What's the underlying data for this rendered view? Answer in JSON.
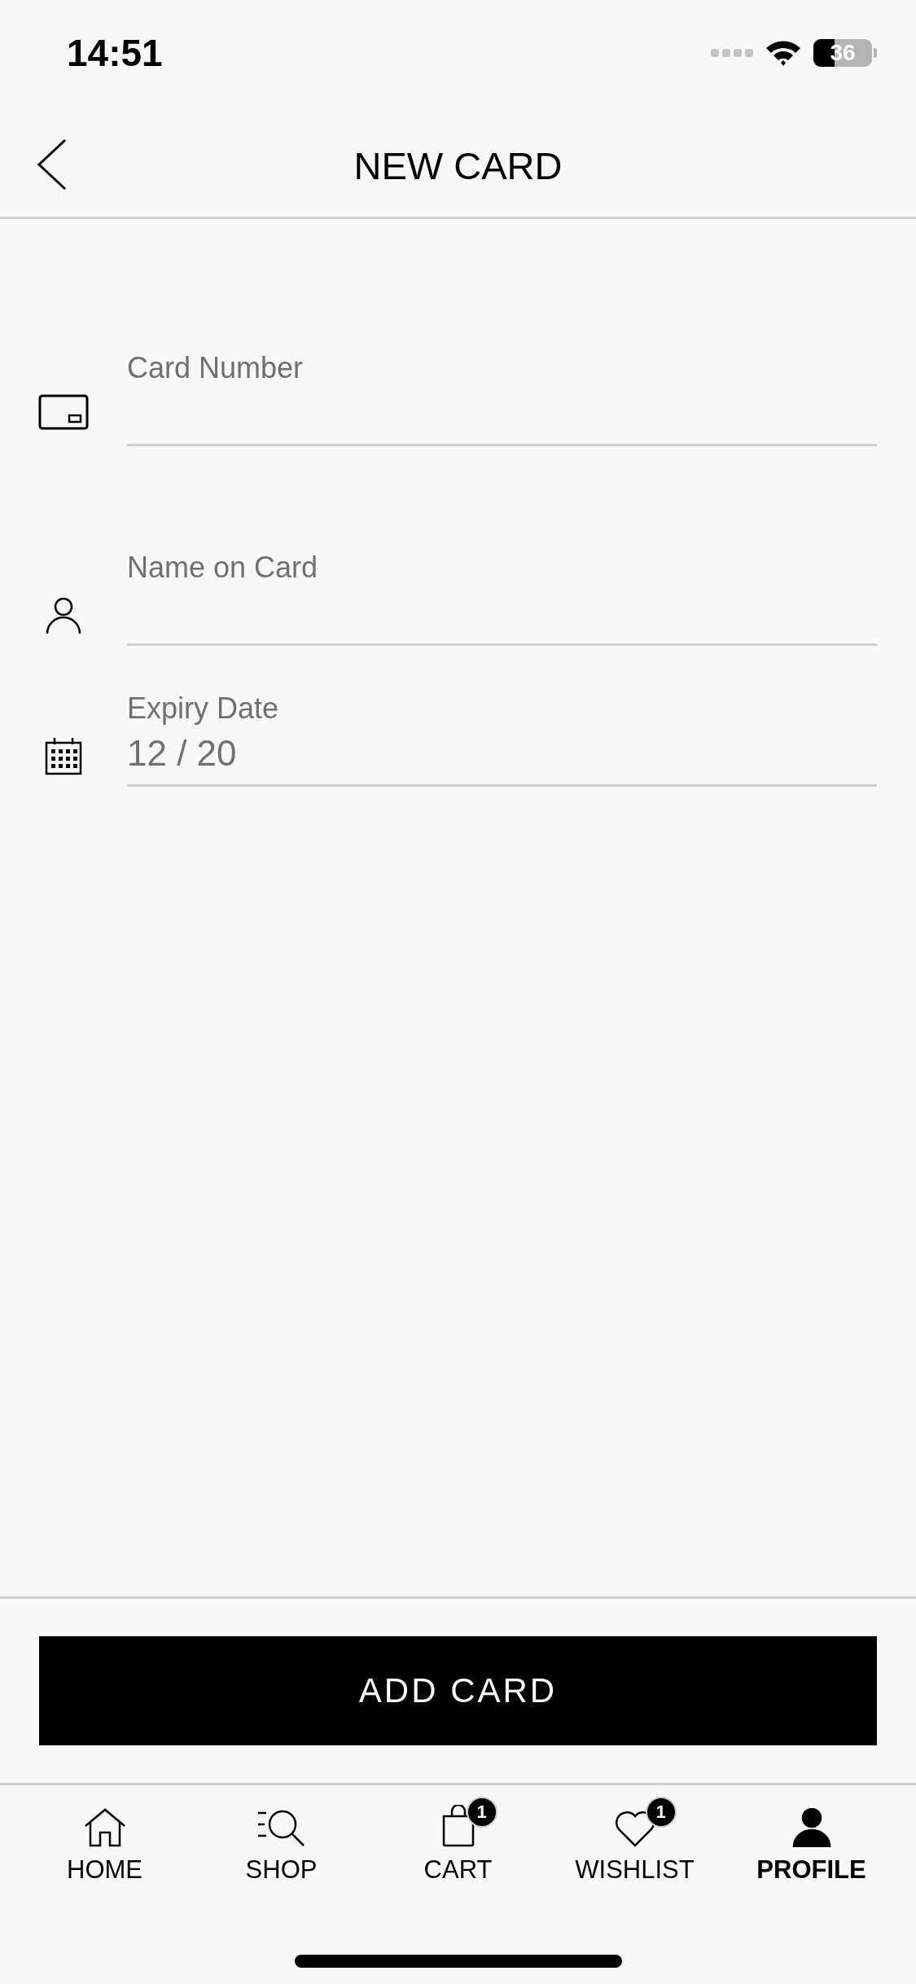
{
  "status_bar": {
    "time": "14:51",
    "battery": "36"
  },
  "header": {
    "title": "NEW CARD"
  },
  "fields": [
    {
      "kind": "card",
      "label": "Card Number"
    },
    {
      "kind": "person",
      "label": "Name on Card"
    },
    {
      "kind": "calendar",
      "label": "Expiry Date",
      "value": "12 / 20"
    }
  ],
  "primary_button": "ADD CARD",
  "tab_bar": [
    {
      "kind": "home",
      "label": "HOME",
      "selected": false
    },
    {
      "kind": "shop",
      "label": "SHOP",
      "selected": false
    },
    {
      "kind": "cart",
      "label": "CART",
      "selected": false,
      "badge": "1"
    },
    {
      "kind": "wishlist",
      "label": "WISHLIST",
      "selected": false,
      "badge": "1"
    },
    {
      "kind": "profile",
      "label": "PROFILE",
      "selected": true
    }
  ]
}
